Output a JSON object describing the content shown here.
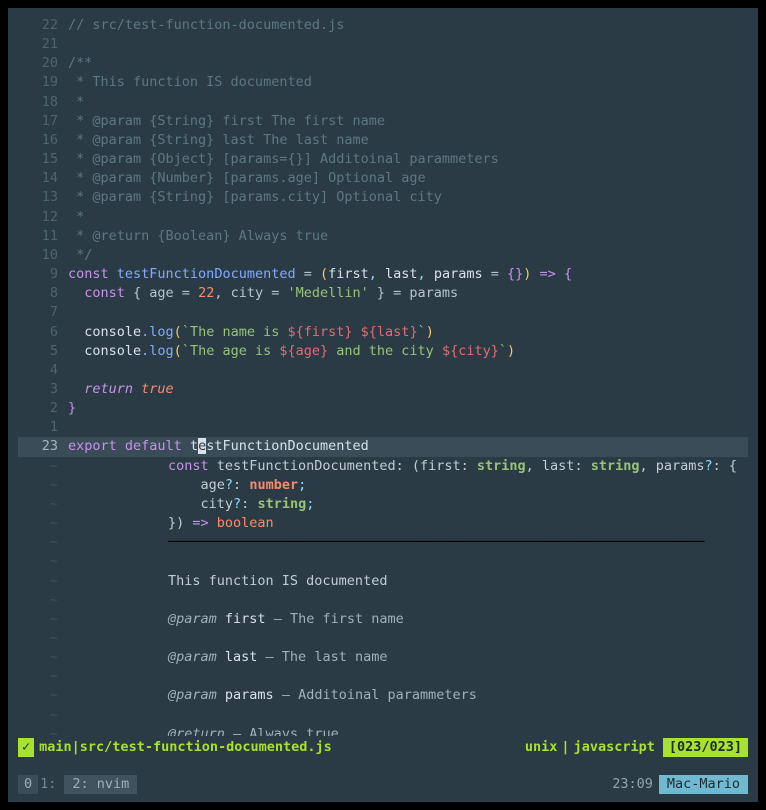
{
  "code": {
    "l22": "// src/test-function-documented.js",
    "l9_const": "const",
    "l9_fn": "testFunctionDocumented",
    "l9_params": "(first, last, params = {}) => {",
    "l8_const": "  const",
    "l8_rest": " { age = ",
    "l8_22": "22",
    "l8_city": ", city = ",
    "l8_med": "'Medellin'",
    "l8_end": " } = params",
    "l6_c": "  console",
    "l6_log": ".log",
    "l6_open": "(`",
    "l6_txt": "The name is ",
    "l6_i1": "${first}",
    "l6_sp": " ",
    "l6_i2": "${last}",
    "l6_close": "`)",
    "l5_txt1": "The age is ",
    "l5_i1": "${age}",
    "l5_txt2": " and the city ",
    "l5_i2": "${city}",
    "l3_ret": "  return",
    "l3_true": " true",
    "l2_brace": "}",
    "l23_export": "export",
    "l23_default": " default ",
    "l23_t": "t",
    "l23_e": "e",
    "l23_rest": "stFunctionDocumented",
    "jsdoc": {
      "a": "/**",
      "b": " * This function IS documented",
      "c": " *",
      "d": " * @param {String} first The first name",
      "e": " * @param {String} last The last name",
      "f": " * @param {Object} [params={}] Additoinal parammeters",
      "g": " * @param {Number} [params.age] Optional age",
      "h": " * @param {String} [params.city] Optional city",
      "i": " *",
      "j": " * @return {Boolean} Always true",
      "k": " */"
    }
  },
  "gutters": {
    "g22": "22",
    "g21": "21",
    "g20": "20",
    "g19": "19",
    "g18": "18",
    "g17": "17",
    "g16": "16",
    "g15": "15",
    "g14": "14",
    "g13": "13",
    "g12": "12",
    "g11": "11",
    "g10": "10",
    "g9": "9",
    "g8": "8",
    "g7": "7",
    "g6": "6",
    "g5": "5",
    "g4": "4",
    "g3": "3",
    "g2": "2",
    "g1": "1",
    "g23": "23"
  },
  "tilde": "~",
  "popup": {
    "sig1_const": "const",
    "sig1_name": " testFunctionDocumented: (",
    "sig1_first": "first",
    "sig1_colon": ": ",
    "sig1_string": "string",
    "sig1_comma": ", ",
    "sig1_last": "last",
    "sig1_params": "params",
    "sig1_q": "?",
    "sig1_ob": ": {",
    "sig2_age": "    age",
    "sig2_num": "number",
    "sig2_semi": ";",
    "sig3_city": "    city",
    "sig4_close": "}) ",
    "sig4_arrow": "=>",
    "sig4_bool": " boolean",
    "hr": "──────────────────────────────────────────────────────────────────",
    "desc": "This function IS documented",
    "p1_tag": "@param",
    "p1_name": " first",
    "p1_rest": " — The first name",
    "p2_tag": "@param",
    "p2_name": " last",
    "p2_rest": " — The last name",
    "p3_tag": "@param",
    "p3_name": " params",
    "p3_rest": " — Additoinal parammeters",
    "r_tag": "@return",
    "r_rest": " — Always true"
  },
  "status": {
    "check": "✓",
    "branch": " main ",
    "sep1": "|",
    "file": " src/test-function-documented.js",
    "enc": "unix ",
    "sep2": "|",
    "lang": " javascript ",
    "pos": "[023/023]"
  },
  "tmux": {
    "session": "0",
    "wlabel": " 1:",
    "window": "2: nvim",
    "time": "23:09",
    "host": "Mac-Mario"
  }
}
